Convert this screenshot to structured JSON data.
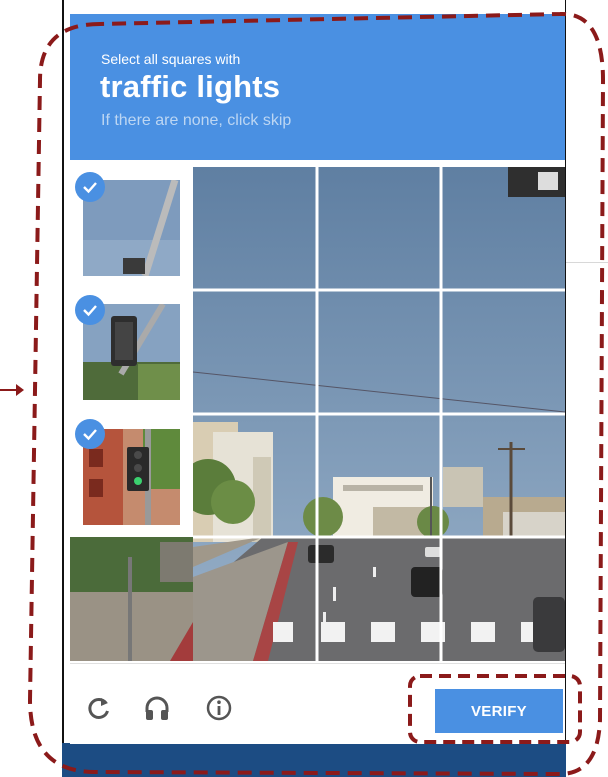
{
  "header": {
    "instruction": "Select all squares with",
    "target": "traffic lights",
    "hint": "If there are none, click skip"
  },
  "examples": [
    {
      "selected": true
    },
    {
      "selected": true
    },
    {
      "selected": true
    }
  ],
  "footer": {
    "reload_icon": "reload-icon",
    "audio_icon": "headphones-icon",
    "info_icon": "info-icon",
    "verify_label": "VERIFY"
  },
  "colors": {
    "accent": "#4a90e2",
    "annotation": "#8b1a1a"
  }
}
